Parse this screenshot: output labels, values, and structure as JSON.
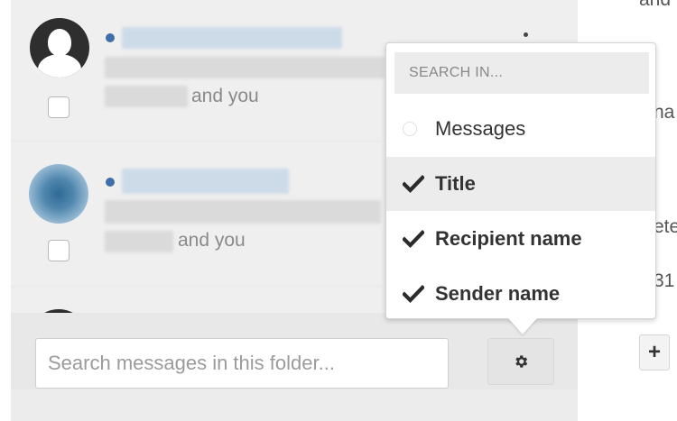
{
  "conversations": [
    {
      "and_you": "and you"
    },
    {
      "and_you": "and you"
    }
  ],
  "search": {
    "placeholder": "Search messages in this folder..."
  },
  "dropdown": {
    "search_in_placeholder": "SEARCH IN...",
    "options": [
      {
        "label": "Messages",
        "checked": false,
        "icon": "radio-icon"
      },
      {
        "label": "Title",
        "checked": true,
        "icon": "check-icon"
      },
      {
        "label": "Recipient name",
        "checked": true,
        "icon": "check-icon"
      },
      {
        "label": "Sender name",
        "checked": true,
        "icon": "check-icon"
      }
    ]
  },
  "right_panel": {
    "fragments": [
      "and",
      "na",
      "ete",
      "31"
    ],
    "plus_label": "+"
  },
  "colors": {
    "unread_dot": "#3f6fa8",
    "panel_bg": "#efefef",
    "highlight_bg": "#ececec"
  },
  "icons": {
    "gear": "gear-icon",
    "check": "check-icon",
    "avatar": "avatar-icon"
  }
}
